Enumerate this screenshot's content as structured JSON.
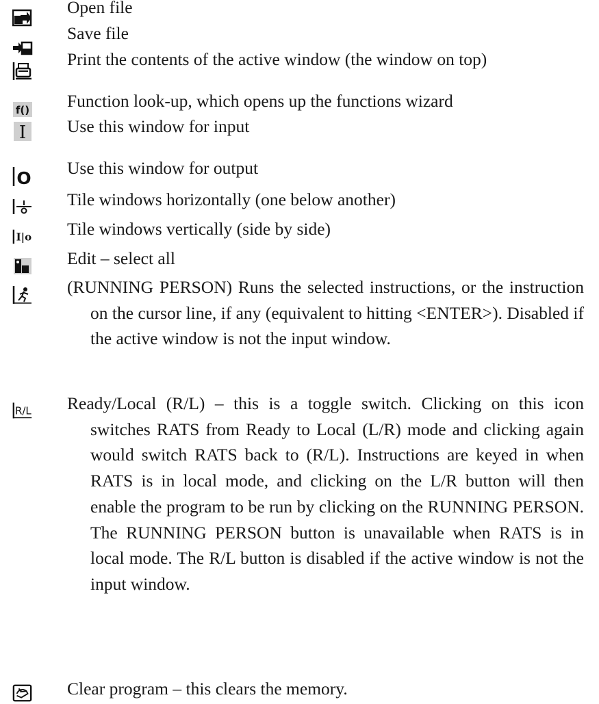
{
  "items": [
    {
      "icon": "open-file-icon",
      "text": "Open file"
    },
    {
      "icon": "save-file-icon",
      "text": "Save file"
    },
    {
      "icon": "print-icon",
      "text": "Print the contents of the active window (the window on top)"
    },
    {
      "icon": "function-icon",
      "text": "Function look-up, which opens up the functions wizard"
    },
    {
      "icon": "input-window-icon",
      "text": "Use this window for input"
    },
    {
      "icon": "output-window-icon",
      "text": "Use this window for output"
    },
    {
      "icon": "tile-horizontal-icon",
      "text": "Tile windows horizontally (one below another)"
    },
    {
      "icon": "tile-vertical-icon",
      "text": "Tile windows vertically (side by side)"
    },
    {
      "icon": "select-all-icon",
      "text": "Edit – select all"
    },
    {
      "icon": "running-person-icon",
      "text": "(RUNNING PERSON) Runs the selected instructions, or the instruction on the cursor line, if any (equivalent to hitting <ENTER>). Disabled if the active window is not the input window."
    },
    {
      "icon": "ready-local-icon",
      "text": "Ready/Local (R/L) – this is a toggle switch. Clicking on this icon switches RATS from Ready to Local (L/R) mode and clicking again would switch RATS back to (R/L). Instructions are keyed in when RATS is in local mode, and clicking on the L/R button will then enable the program to be run by clicking on the RUNNING PERSON. The RUNNING PERSON button is unavailable when RATS is in local mode. The R/L button is disabled if the active window is not the input window."
    },
    {
      "icon": "clear-program-icon",
      "text": "Clear program – this clears the memory."
    }
  ],
  "icon_glyphs": {
    "function": "f()",
    "input": "I",
    "output": "O",
    "tile_vertical": "I|o",
    "ready_local": "R/L"
  }
}
